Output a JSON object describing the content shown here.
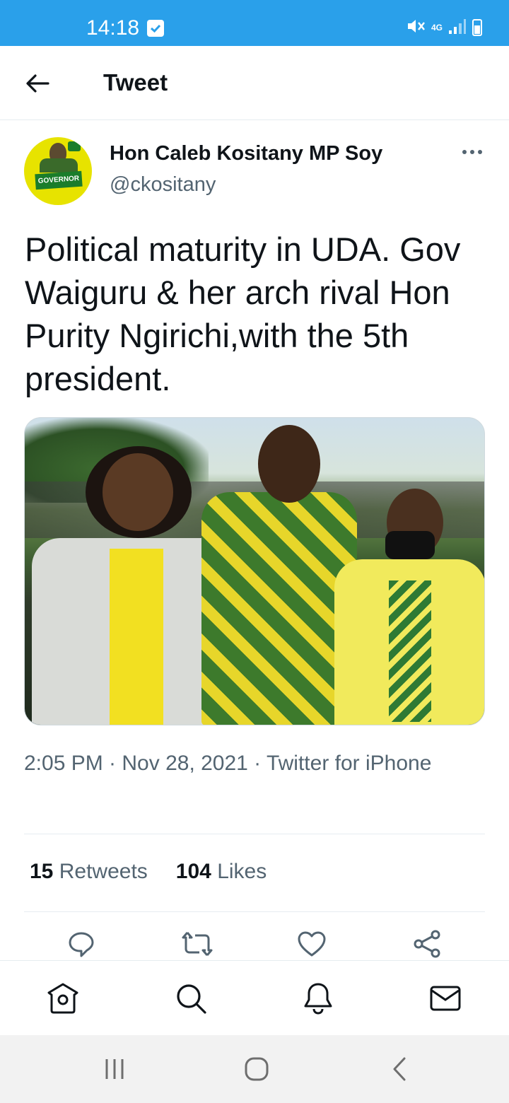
{
  "status_bar": {
    "time": "14:18",
    "network": "4G",
    "bg_color": "#2aa0ea"
  },
  "header": {
    "back_icon": "arrow-left-icon",
    "title": "Tweet"
  },
  "tweet": {
    "author": {
      "name": "Hon Caleb Kositany MP Soy",
      "handle": "@ckositany",
      "avatar_text": "GOVERNOR"
    },
    "more_icon": "more-horizontal-icon",
    "text": "Political maturity in UDA. Gov Waiguru & her arch rival Hon Purity Ngirichi,with the 5th president.",
    "meta": "2:05 PM · Nov 28, 2021 · Twitter for iPhone",
    "stats": {
      "retweets_count": "15",
      "retweets_label": "Retweets",
      "likes_count": "104",
      "likes_label": "Likes"
    },
    "actions": [
      {
        "name": "reply",
        "icon": "reply-icon"
      },
      {
        "name": "retweet",
        "icon": "retweet-icon"
      },
      {
        "name": "like",
        "icon": "heart-icon"
      },
      {
        "name": "share",
        "icon": "share-icon"
      }
    ]
  },
  "bottom_nav": [
    {
      "name": "home",
      "icon": "home-icon"
    },
    {
      "name": "search",
      "icon": "search-icon"
    },
    {
      "name": "notifications",
      "icon": "bell-icon"
    },
    {
      "name": "messages",
      "icon": "mail-icon"
    }
  ],
  "system_nav": [
    {
      "name": "recents",
      "icon": "recents-icon"
    },
    {
      "name": "home",
      "icon": "home-circle-icon"
    },
    {
      "name": "back",
      "icon": "chevron-left-icon"
    }
  ],
  "colors": {
    "accent": "#1d9bf0",
    "text_primary": "#0f1419",
    "text_secondary": "#536471",
    "divider": "#e6ecf0"
  }
}
